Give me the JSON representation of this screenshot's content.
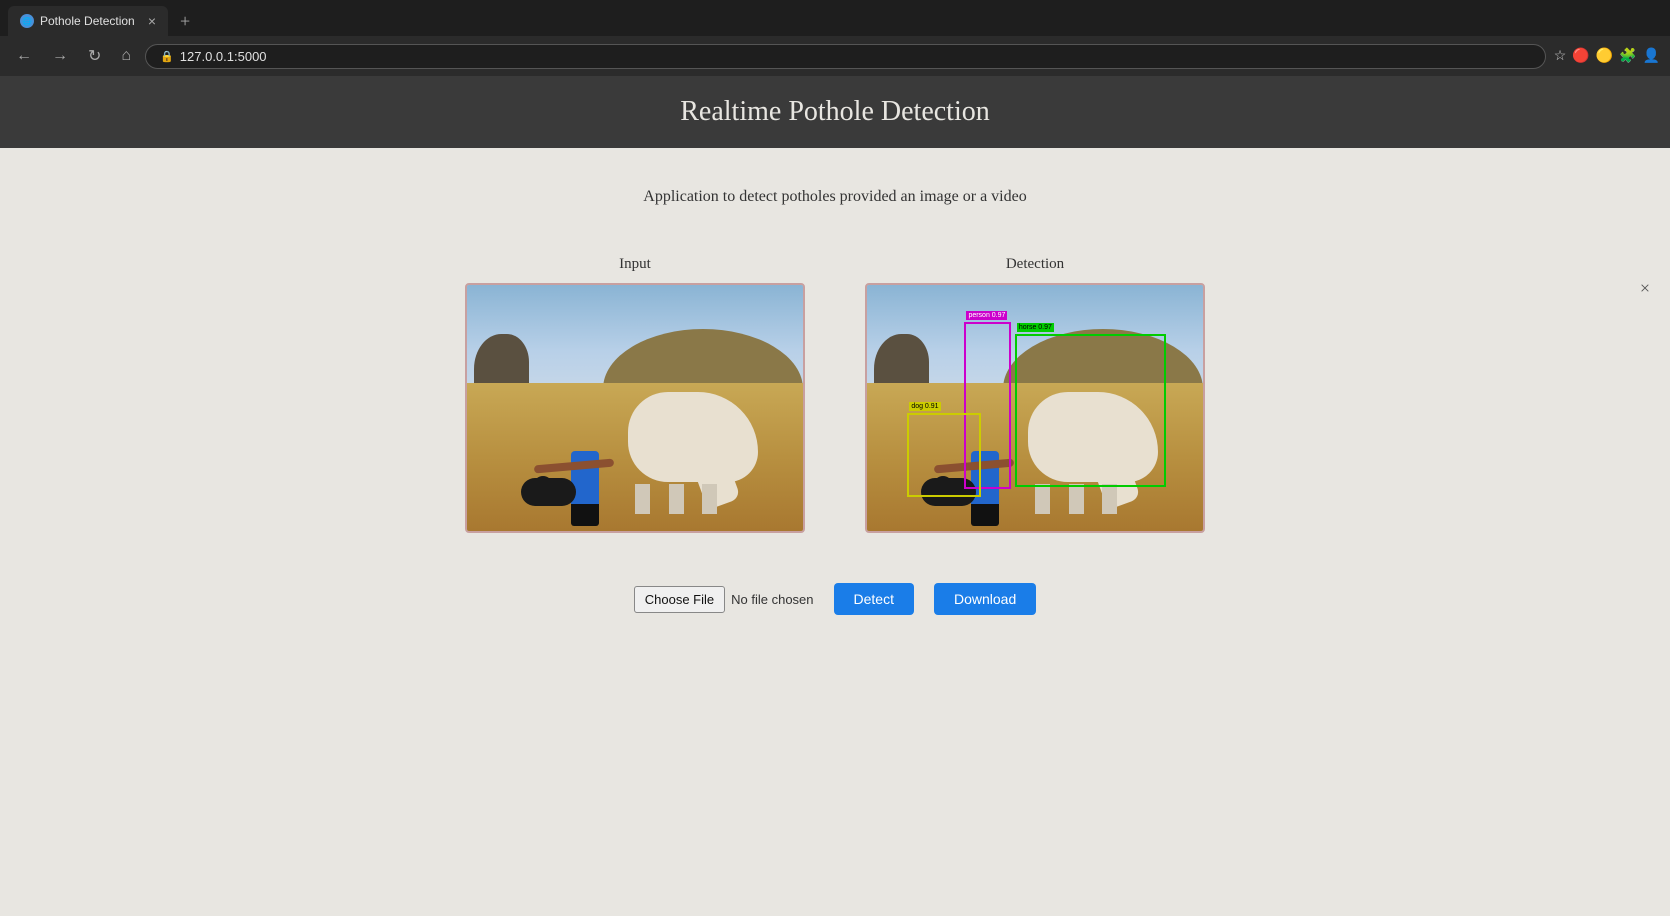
{
  "browser": {
    "tab_title": "Pothole Detection",
    "tab_favicon": "🌐",
    "new_tab_icon": "+",
    "back_icon": "←",
    "forward_icon": "→",
    "refresh_icon": "↻",
    "home_icon": "⌂",
    "address": "127.0.0.1:5000",
    "lock_icon": "🔒",
    "star_icon": "☆",
    "extensions_icons": [
      "🔴",
      "🟡",
      "🧩",
      "👤"
    ],
    "close_tab_icon": "×"
  },
  "page": {
    "title": "Realtime Pothole Detection",
    "subtitle": "Application to detect potholes provided an image or a video",
    "input_label": "Input",
    "detection_label": "Detection",
    "close_icon": "×"
  },
  "controls": {
    "file_button_label": "Choose File",
    "file_name_placeholder": "No file chosen",
    "detect_button_label": "Detect",
    "download_button_label": "Download"
  },
  "detections": {
    "person_label": "person 0.97",
    "dog_label": "dog 0.91",
    "horse_label": "horse 0.97"
  }
}
